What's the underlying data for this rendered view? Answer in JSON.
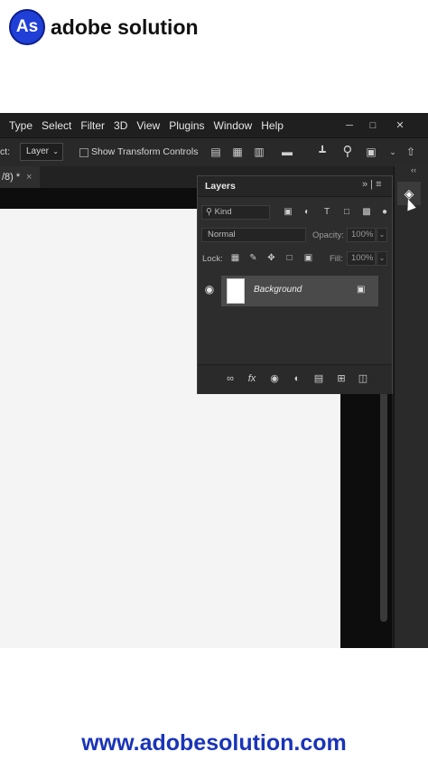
{
  "brand": {
    "logo_text": "As",
    "name": "adobe solution"
  },
  "footer": {
    "url": "www.adobesolution.com"
  },
  "menubar": {
    "items": [
      "Type",
      "Select",
      "Filter",
      "3D",
      "View",
      "Plugins",
      "Window",
      "Help"
    ],
    "window_controls": [
      "minimize-icon",
      "restore-icon",
      "close-icon"
    ]
  },
  "options_bar": {
    "label": "ct:",
    "target_select": "Layer",
    "checkbox_label": "Show Transform Controls"
  },
  "document_tab": {
    "title": "/8) *",
    "close": "×"
  },
  "layers_panel": {
    "title": "Layers",
    "filter_kind": "Kind",
    "blend_mode": "Normal",
    "opacity_label": "Opacity:",
    "opacity_value": "100%",
    "lock_label": "Lock:",
    "fill_label": "Fill:",
    "fill_value": "100%",
    "layers": [
      {
        "name": "Background",
        "visible": true,
        "locked": true
      }
    ]
  },
  "colors": {
    "brand_blue": "#1f3fd6",
    "panel_bg": "#2d2d2d",
    "canvas_bg": "#f4f4f4"
  }
}
